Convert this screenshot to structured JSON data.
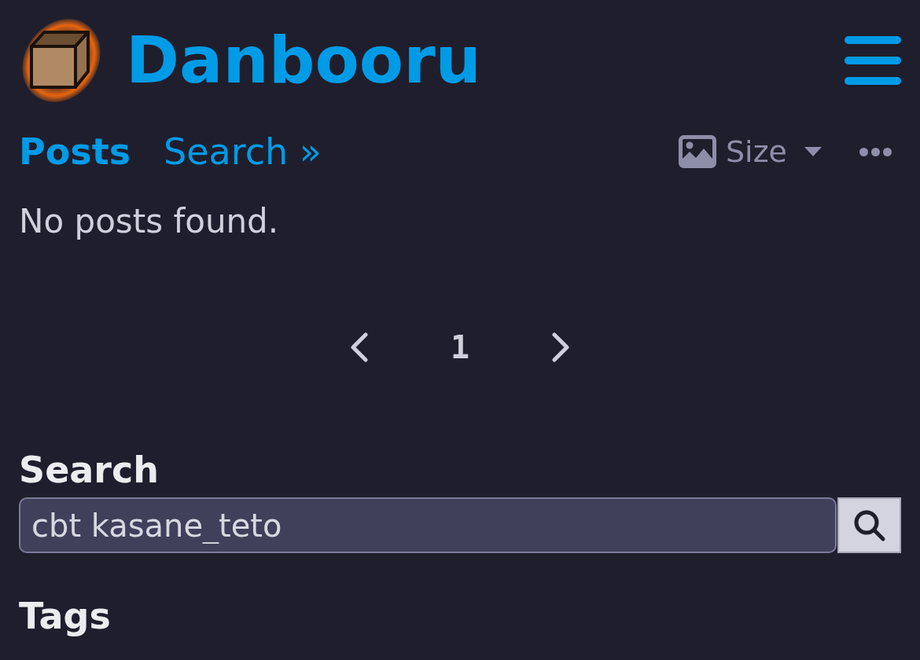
{
  "header": {
    "title": "Danbooru"
  },
  "nav": {
    "items": [
      {
        "label": "Posts",
        "selected": true
      },
      {
        "label": "Search »",
        "selected": false
      }
    ],
    "size_menu": {
      "label": "Size"
    }
  },
  "results": {
    "message": "No posts found."
  },
  "pagination": {
    "pages": [
      {
        "label": "1",
        "selected": true
      }
    ]
  },
  "search": {
    "heading": "Search",
    "value": "cbt kasane_teto"
  },
  "tags": {
    "heading": "Tags"
  }
}
